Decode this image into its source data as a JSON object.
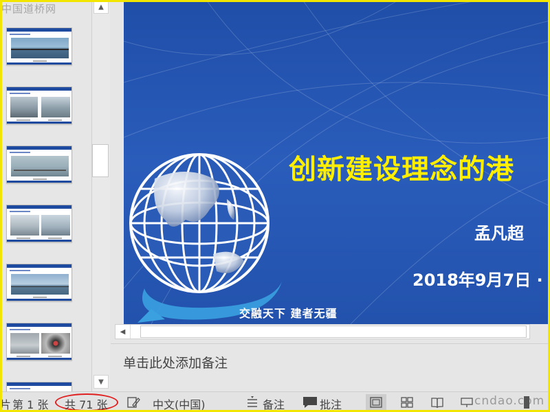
{
  "watermark": "中国道桥网",
  "thumbnails": [
    {
      "index": 1,
      "scene": "bridge-over-sea"
    },
    {
      "index": 2,
      "scene": "two-construction-photos"
    },
    {
      "index": 3,
      "scene": "sea-bridge-aerial"
    },
    {
      "index": 4,
      "scene": "steel-girder-photos"
    },
    {
      "index": 5,
      "scene": "bridge-horizon"
    },
    {
      "index": 6,
      "scene": "tunnel-photos"
    },
    {
      "index": 7,
      "scene": "partial"
    }
  ],
  "slide": {
    "title": "创新建设理念的港",
    "author": "孟凡超",
    "date": "2018年9月7日 ·",
    "slogan": "交融天下   建者无疆",
    "background_color": "#2455b3",
    "title_color": "#ffee00"
  },
  "notes": {
    "placeholder": "单击此处添加备注"
  },
  "statusbar": {
    "slide_position": "第 1 张",
    "slide_total": "共 71 张",
    "language": "中文(中国)",
    "notes_label": "备注",
    "comments_label": "批注",
    "left_fragment": "片",
    "watermark": "cndao.com"
  },
  "colors": {
    "frame": "#f2e600",
    "highlight_ellipse": "#e02020"
  }
}
